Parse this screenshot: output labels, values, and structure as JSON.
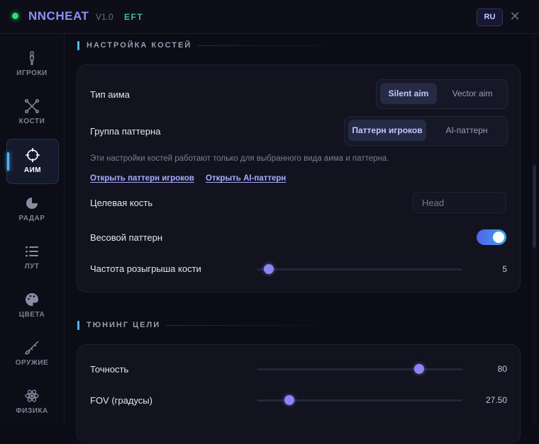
{
  "app": {
    "title": "NNCHEAT",
    "version": "V1.0",
    "game": "EFT",
    "lang": "RU",
    "close_glyph": "✕",
    "accent": "#8d8ff5",
    "status_color": "#27e07a"
  },
  "sidebar": {
    "items": [
      {
        "label": "ИГРОКИ",
        "icon": "person-icon",
        "active": false
      },
      {
        "label": "КОСТИ",
        "icon": "bones-icon",
        "active": false
      },
      {
        "label": "АИМ",
        "icon": "crosshair-icon",
        "active": true
      },
      {
        "label": "РАДАР",
        "icon": "radar-icon",
        "active": false
      },
      {
        "label": "ЛУТ",
        "icon": "list-icon",
        "active": false
      },
      {
        "label": "ЦВЕТА",
        "icon": "palette-icon",
        "active": false
      },
      {
        "label": "ОРУЖИЕ",
        "icon": "rifle-icon",
        "active": false
      },
      {
        "label": "ФИЗИКА",
        "icon": "atom-icon",
        "active": false
      }
    ]
  },
  "bones_section": {
    "title": "НАСТРОЙКА КОСТЕЙ",
    "aim_type": {
      "label": "Тип аима",
      "options": [
        "Silent aim",
        "Vector aim"
      ],
      "selected": "Silent aim"
    },
    "pattern_group": {
      "label": "Группа паттерна",
      "options": [
        "Паттерн игроков",
        "AI-паттерн"
      ],
      "selected": "Паттерн игроков"
    },
    "hint": "Эти настройки костей работают только для выбранного вида аима и паттерна.",
    "links": [
      "Открыть паттерн игроков",
      "Открыть AI-паттерн"
    ],
    "target_bone": {
      "label": "Целевая кость",
      "value": "Head"
    },
    "weighted_pattern": {
      "label": "Весовой паттерн",
      "enabled": true
    },
    "bone_roll_rate": {
      "label": "Частота розыгрыша кости",
      "value": "5",
      "fraction": 0.06
    }
  },
  "tuning_section": {
    "title": "ТЮНИНГ ЦЕЛИ",
    "accuracy": {
      "label": "Точность",
      "value": "80",
      "fraction": 0.79
    },
    "fov": {
      "label": "FOV (градусы)",
      "value": "27.50",
      "fraction": 0.16
    }
  }
}
